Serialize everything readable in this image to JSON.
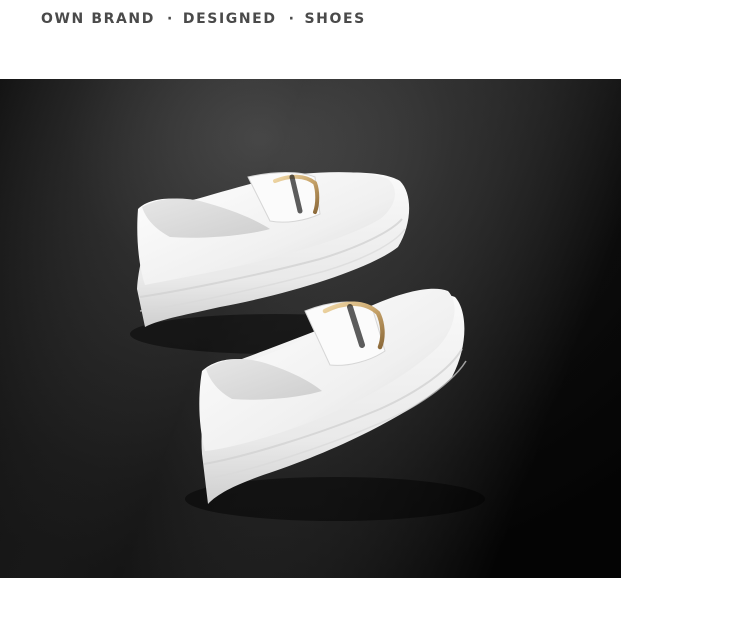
{
  "header": {
    "part1": "OWN BRAND",
    "separator": "·",
    "part2": "DESIGNED",
    "part3": "SHOES",
    "text_color": "#4a4a4a"
  },
  "photo": {
    "subject": "white-leather-platform-loafers",
    "background_color": "#0d0d0d",
    "shoe_color": "#f4f4f4",
    "buckle_color": "#c8a46a"
  }
}
